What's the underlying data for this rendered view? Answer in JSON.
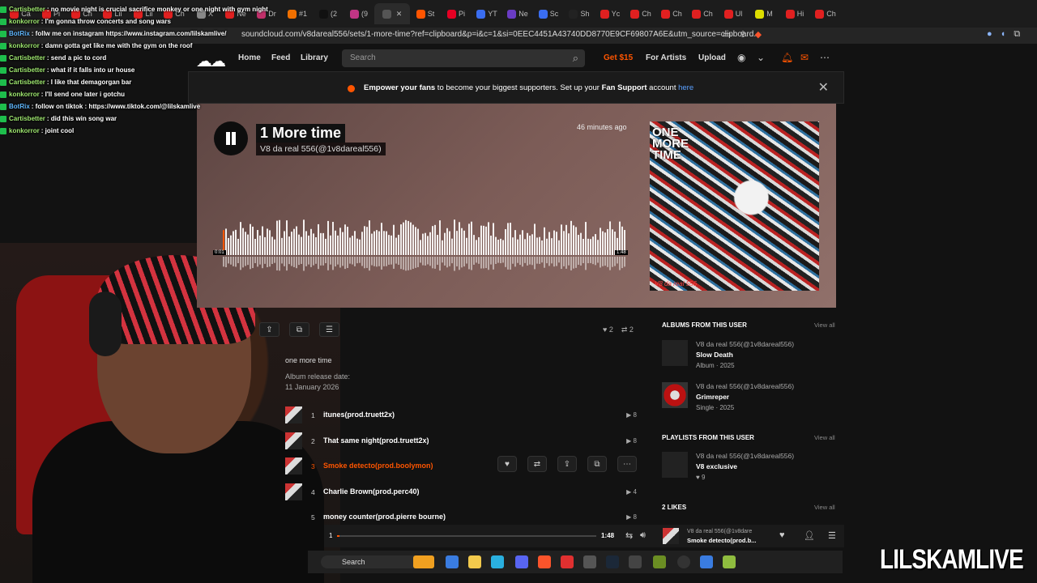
{
  "browser": {
    "tabs": [
      {
        "label": "Ca",
        "color": "#e02020"
      },
      {
        "label": "Pi",
        "color": "#e02020"
      },
      {
        "label": "Ch",
        "color": "#e02020"
      },
      {
        "label": "Lil",
        "color": "#e02020"
      },
      {
        "label": "Lil",
        "color": "#e02020"
      },
      {
        "label": "Ch",
        "color": "#e02020"
      },
      {
        "label": "X",
        "color": "#888888"
      },
      {
        "label": "Ne",
        "color": "#e02020"
      },
      {
        "label": "Dr",
        "color": "#c0306a"
      },
      {
        "label": "#1",
        "color": "#f07000"
      },
      {
        "label": "(2",
        "color": "#111111"
      },
      {
        "label": "(9",
        "color": "#c13584"
      },
      {
        "label": "",
        "color": "#555555",
        "active": true
      },
      {
        "label": "St",
        "color": "#ff5500"
      },
      {
        "label": "Pi",
        "color": "#e60023"
      },
      {
        "label": "YT",
        "color": "#3a6df0"
      },
      {
        "label": "Ne",
        "color": "#6a3cc4"
      },
      {
        "label": "Sc",
        "color": "#3a6df0"
      },
      {
        "label": "Sh",
        "color": "#222222"
      },
      {
        "label": "Yc",
        "color": "#e02020"
      },
      {
        "label": "Ch",
        "color": "#e02020"
      },
      {
        "label": "Ch",
        "color": "#e02020"
      },
      {
        "label": "Ch",
        "color": "#e02020"
      },
      {
        "label": "Ul",
        "color": "#e02020"
      },
      {
        "label": "M",
        "color": "#dddd00"
      },
      {
        "label": "Hi",
        "color": "#e02020"
      },
      {
        "label": "Ch",
        "color": "#e02020"
      }
    ],
    "url": "soundcloud.com/v8dareal556/sets/1-more-time?ref=clipboard&p=i&c=1&si=0EEC4451A43740DD8770E9CF69807A6E&utm_source=clipboard..."
  },
  "chat": [
    {
      "user": "Cartisbetter",
      "text": ": no movie night is crucial sacrifice monkey or one night with gym night",
      "bot": false
    },
    {
      "user": "konkorror",
      "text": ": I'm gonna throw concerts and song wars",
      "bot": false
    },
    {
      "user": "BotRix",
      "text": ": follw me on instagram https://www.instagram.com/lilskamlive/",
      "bot": true
    },
    {
      "user": "konkorror",
      "text": ": damn gotta get like me with the gym on the roof",
      "bot": false
    },
    {
      "user": "Cartisbetter",
      "text": ": send a pic to cord",
      "bot": false
    },
    {
      "user": "Cartisbetter",
      "text": ": what if it falls into ur house",
      "bot": false
    },
    {
      "user": "Cartisbetter",
      "text": ": I like that demagorgan bar",
      "bot": false
    },
    {
      "user": "konkorror",
      "text": ": I'll send one later i gotchu",
      "bot": false
    },
    {
      "user": "BotRix",
      "text": ": follow on tiktok : https://www.tiktok.com/@lilskamlive",
      "bot": true
    },
    {
      "user": "Cartisbetter",
      "text": ": did this win song war",
      "bot": false
    },
    {
      "user": "konkorror",
      "text": ": joint cool",
      "bot": false
    }
  ],
  "nav": {
    "home": "Home",
    "feed": "Feed",
    "library": "Library",
    "search_placeholder": "Search",
    "get": "Get $15",
    "for_artists": "For Artists",
    "upload": "Upload"
  },
  "banner": {
    "bold1": "Empower your fans",
    "text1": " to become your biggest supporters. Set up your ",
    "bold2": "Fan Support",
    "text2": " account ",
    "link": "here"
  },
  "hero": {
    "title": "1 More time",
    "artist": "V8 da real 556(@1v8dareal556)",
    "posted": "46 minutes ago",
    "time_current": "0:01",
    "time_total": "1:48",
    "cover_text": "ONE MORE TIME",
    "cover_sig": "V8 da real 556",
    "accent": "#ff5500"
  },
  "stats": {
    "likes": "2",
    "reposts": "2"
  },
  "description": "one more time",
  "release": {
    "label": "Album release date:",
    "date": "11 January 2026"
  },
  "tracks": [
    {
      "num": "1",
      "title": "itunes(prod.truett2x)",
      "plays": "8",
      "active": false
    },
    {
      "num": "2",
      "title": "That same night(prod.truett2x)",
      "plays": "8",
      "active": false
    },
    {
      "num": "3",
      "title": "Smoke detecto(prod.boolymon)",
      "plays": "",
      "active": true
    },
    {
      "num": "4",
      "title": "Charlie Brown(prod.perc40)",
      "plays": "4",
      "active": false
    },
    {
      "num": "5",
      "title": "money counter(prod.pierre bourne)",
      "plays": "8",
      "active": false
    }
  ],
  "sidebar": {
    "albums_head": "ALBUMS FROM THIS USER",
    "playlists_head": "PLAYLISTS FROM THIS USER",
    "likes_head": "2 LIKES",
    "view_all": "View all",
    "albums": [
      {
        "artist": "V8 da real 556(@1v8dareal556)",
        "title": "Slow Death",
        "sub": "Album · 2025"
      },
      {
        "artist": "V8 da real 556(@1v8dareal556)",
        "title": "Grimreper",
        "sub": "Single · 2025"
      }
    ],
    "playlists": [
      {
        "artist": "V8 da real 556(@1v8dareal556)",
        "title": "V8 exclusive",
        "sub": "9"
      }
    ]
  },
  "player": {
    "current": "1",
    "total": "1:48",
    "progress": 0.01,
    "artist": "V8 da real 556(@1v8dare",
    "title": "Smoke detecto(prod.b..."
  },
  "taskbar": {
    "search": "Search"
  },
  "watermark": "LILSKAMLIVE"
}
